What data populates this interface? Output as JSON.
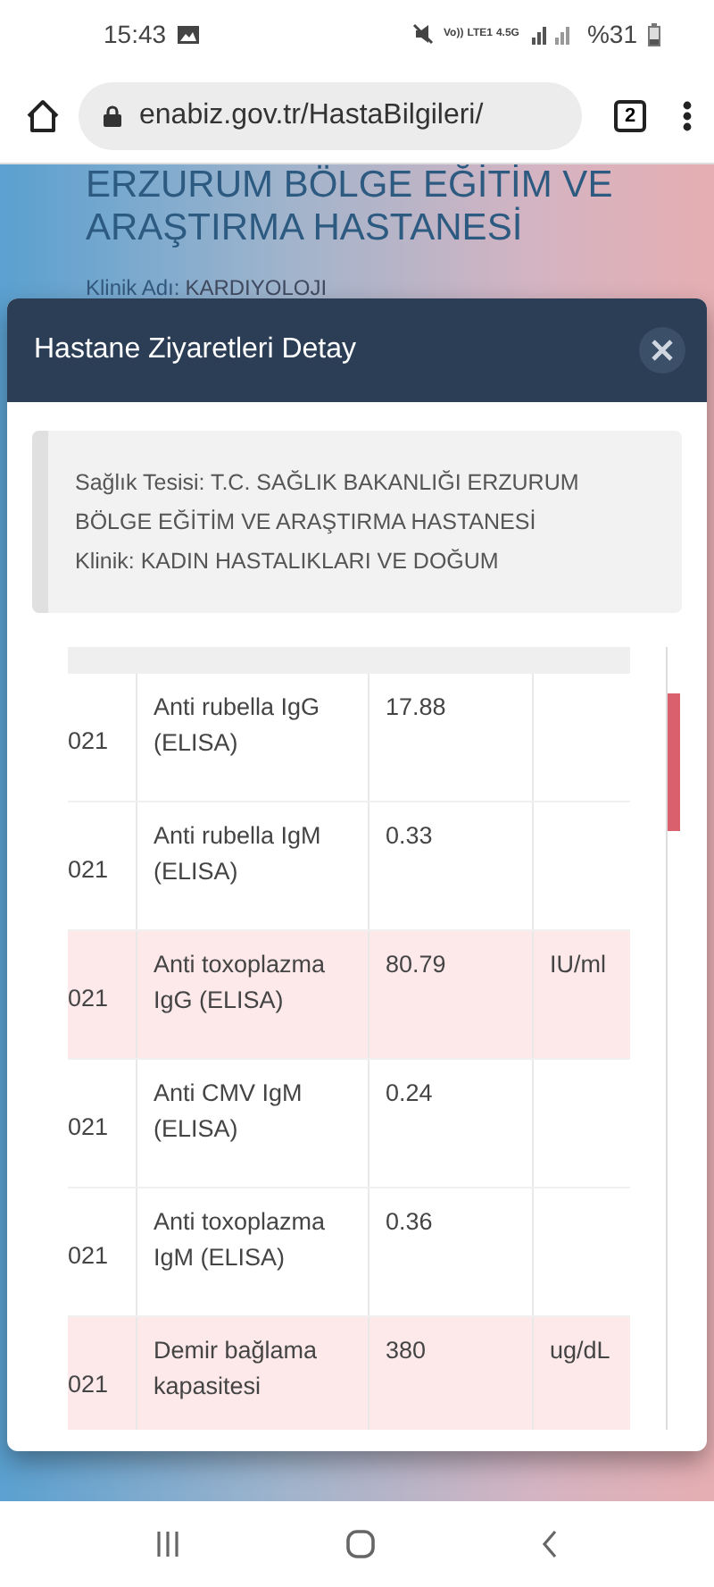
{
  "status_bar": {
    "time": "15:43",
    "network_labels": [
      "Vo))",
      "LTE1",
      "4.5G"
    ],
    "battery": "%31"
  },
  "browser": {
    "url": "enabiz.gov.tr/HastaBilgileri/",
    "tab_count": "2"
  },
  "background_page": {
    "heading_lines": [
      "ERZURUM BÖLGE EĞİTİM VE",
      "ARAŞTIRMA HASTANESİ"
    ],
    "clinic_label": "Klinik Adı:",
    "clinic_value": "KARDIYOLOJI"
  },
  "modal": {
    "title": "Hastane Ziyaretleri Detay",
    "info_lines": [
      "Sağlık Tesisi: T.C. SAĞLIK BAKANLIĞI ERZURUM BÖLGE EĞİTİM VE ARAŞTIRMA HASTANESİ",
      "Klinik: KADIN HASTALIKLARI VE DOĞUM"
    ],
    "table": {
      "rows": [
        {
          "date": "021",
          "test": "Anti rubella IgG (ELISA)",
          "value": "17.88",
          "unit": "",
          "abnormal": false
        },
        {
          "date": "021",
          "test": "Anti rubella IgM (ELISA)",
          "value": "0.33",
          "unit": "",
          "abnormal": false
        },
        {
          "date": "021",
          "test": "Anti toxoplazma IgG (ELISA)",
          "value": "80.79",
          "unit": "IU/ml",
          "abnormal": true
        },
        {
          "date": "021",
          "test": "Anti CMV IgM (ELISA)",
          "value": "0.24",
          "unit": "",
          "abnormal": false
        },
        {
          "date": "021",
          "test": "Anti toxoplazma IgM (ELISA)",
          "value": "0.36",
          "unit": "",
          "abnormal": false
        },
        {
          "date": "021",
          "test": "Demir bağlama kapasitesi",
          "value": "380",
          "unit": "ug/dL",
          "abnormal": true
        }
      ]
    }
  }
}
